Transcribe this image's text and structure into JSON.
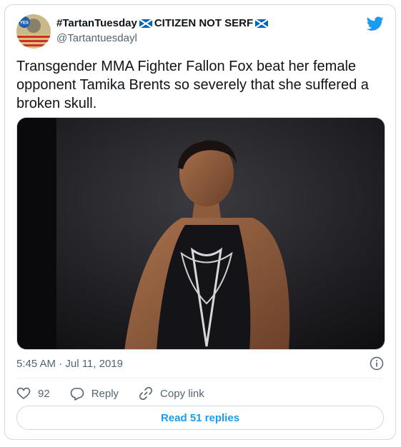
{
  "author": {
    "display_name": "#TartanTuesday 🏴󠁧󠁢󠁳󠁣󠁴󠁿CITIZEN NOT SERF🏴󠁧󠁢󠁳󠁣󠁴󠁿",
    "name_part1": "#TartanTuesday",
    "name_part2": "CITIZEN NOT SERF",
    "handle": "@Tartantuesdayl",
    "avatar_badge": "YES",
    "flag_icon": "scotland-flag-icon"
  },
  "tweet": {
    "text": "Transgender MMA Fighter Fallon Fox beat her female opponent Tamika Brents so severely that she suffered a broken skull.",
    "timestamp": "5:45 AM · Jul 11, 2019"
  },
  "actions": {
    "like_count": "92",
    "reply_label": "Reply",
    "copy_link_label": "Copy link",
    "read_replies_label": "Read 51 replies"
  },
  "colors": {
    "brand": "#1d9bf0",
    "text": "#0f1419",
    "secondary": "#536471",
    "border": "#cfd9de"
  },
  "icons": [
    "twitter-bird-icon",
    "info-icon",
    "heart-icon",
    "reply-icon",
    "copy-link-icon",
    "scotland-flag-icon"
  ]
}
